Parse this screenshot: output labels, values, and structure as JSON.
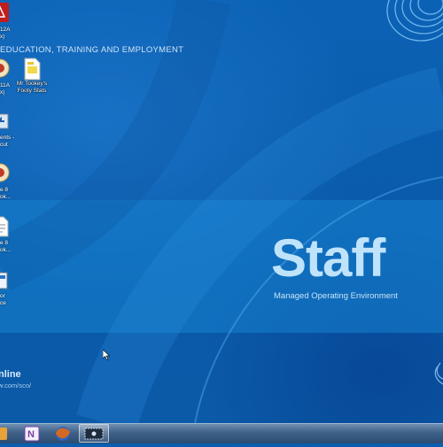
{
  "wallpaper": {
    "department": "EDUCATION, TRAINING AND EMPLOYMENT",
    "brand_title": "Staff",
    "brand_subtitle": "Managed Operating Environment",
    "online_text": "nline",
    "online_url": "w.com/sco/"
  },
  "desktop_icons": [
    {
      "label": "12A\nx)",
      "icon": "pdf-icon"
    },
    {
      "label": "11A\nx)",
      "icon": "media-icon"
    },
    {
      "label": "Mr Tookey's\nFooty Stats",
      "icon": "document-icon"
    },
    {
      "label": "ents -\ncut",
      "icon": "shortcut-icon"
    },
    {
      "label": "e 8\nok...",
      "icon": "media-icon"
    },
    {
      "label": "e 8\nok...",
      "icon": "document-icon"
    },
    {
      "label": "or\nce",
      "icon": "app-icon"
    }
  ],
  "taskbar": {
    "items": [
      {
        "name": "taskbar-item-partial",
        "icon": "partial-icon"
      },
      {
        "name": "taskbar-onenote",
        "icon": "onenote-icon"
      },
      {
        "name": "taskbar-firefox",
        "icon": "firefox-icon"
      },
      {
        "name": "taskbar-recorder",
        "icon": "recorder-icon"
      }
    ]
  },
  "colors": {
    "desktop_blue": "#0a5fb0",
    "brand_text": "#bfe3fa",
    "taskbar": "#3f6188"
  }
}
